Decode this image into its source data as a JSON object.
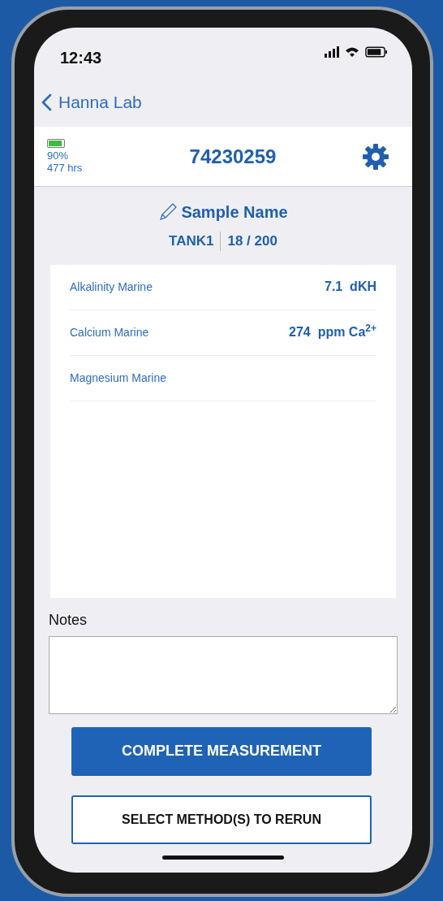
{
  "status_bar": {
    "time": "12:43"
  },
  "nav": {
    "back_label": "Hanna Lab"
  },
  "device": {
    "battery": {
      "level": 0.9,
      "percent": "90%",
      "hours": "477 hrs"
    },
    "serial": "74230259"
  },
  "sample": {
    "name": "Sample Name",
    "tank": "TANK1",
    "count": "18 / 200"
  },
  "results": [
    {
      "method": "Alkalinity Marine",
      "value": "7.1  dKH"
    },
    {
      "method": "Calcium Marine",
      "value": "274  ppm Ca$^{2+}$"
    },
    {
      "method": "Magnesium Marine"
    }
  ],
  "notes": {
    "label": "Notes"
  },
  "buttons": [
    {
      "label": "COMPLETE MEASUREMENT",
      "kind": "primary"
    },
    {
      "label": "SELECT METHOD(S) TO RERUN",
      "kind": "outline"
    }
  ]
}
